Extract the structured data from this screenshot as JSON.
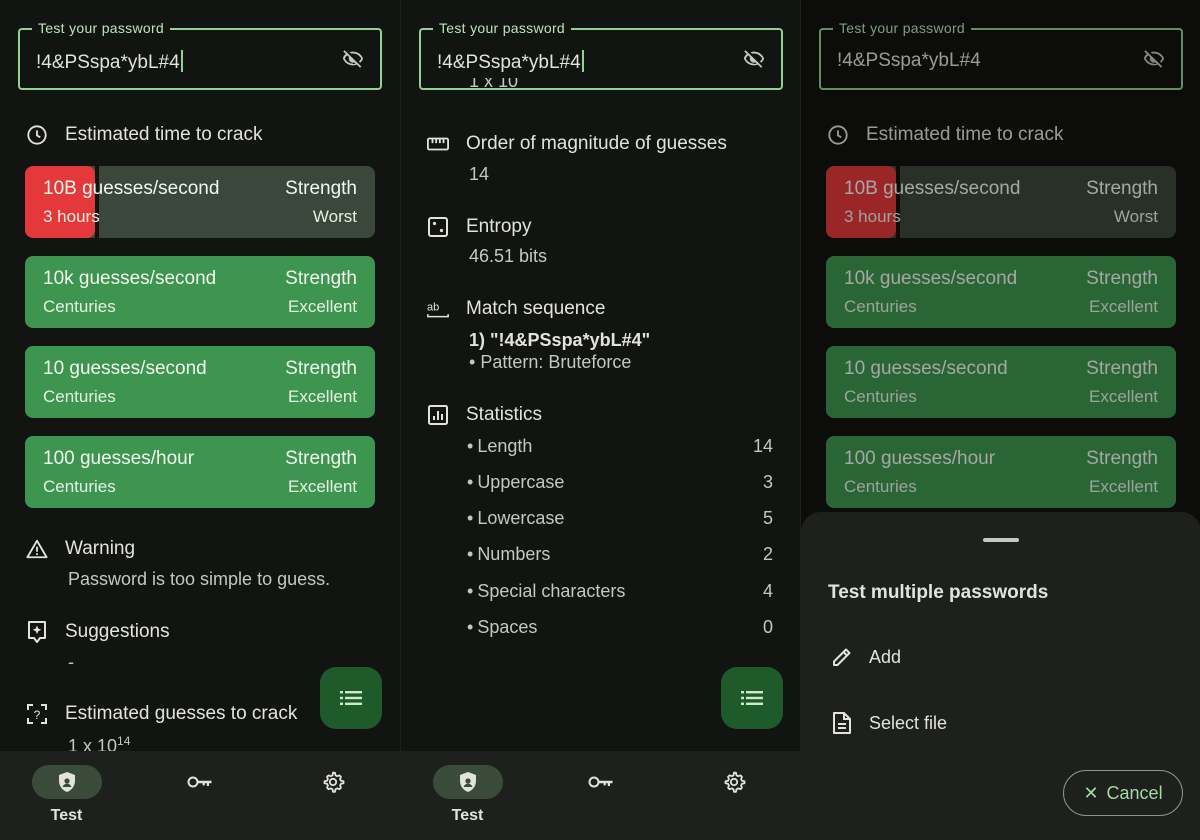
{
  "password_field": {
    "label": "Test your password",
    "value": "!4&PSspa*ybL#4"
  },
  "crack_time": {
    "title": "Estimated time to crack",
    "cards": [
      {
        "rate": "10B guesses/second",
        "time": "3 hours",
        "strength_label": "Strength",
        "strength": "Worst"
      },
      {
        "rate": "10k guesses/second",
        "time": "Centuries",
        "strength_label": "Strength",
        "strength": "Excellent"
      },
      {
        "rate": "10 guesses/second",
        "time": "Centuries",
        "strength_label": "Strength",
        "strength": "Excellent"
      },
      {
        "rate": "100 guesses/hour",
        "time": "Centuries",
        "strength_label": "Strength",
        "strength": "Excellent"
      }
    ]
  },
  "warning": {
    "title": "Warning",
    "text": "Password is too simple to guess."
  },
  "suggestions": {
    "title": "Suggestions",
    "text": "-"
  },
  "guesses": {
    "title": "Estimated guesses to crack",
    "base": "1 x 10",
    "exponent": "14",
    "cut_text": "1 x 10"
  },
  "magnitude": {
    "title": "Order of magnitude of guesses",
    "value": "14"
  },
  "entropy": {
    "title": "Entropy",
    "value": "46.51 bits"
  },
  "match_sequence": {
    "title": "Match sequence",
    "item": "1) \"!4&PSspa*ybL#4\"",
    "pattern": "Pattern: Bruteforce"
  },
  "statistics": {
    "title": "Statistics",
    "rows": [
      {
        "label": "Length",
        "value": "14"
      },
      {
        "label": "Uppercase",
        "value": "3"
      },
      {
        "label": "Lowercase",
        "value": "5"
      },
      {
        "label": "Numbers",
        "value": "2"
      },
      {
        "label": "Special characters",
        "value": "4"
      },
      {
        "label": "Spaces",
        "value": "0"
      }
    ]
  },
  "nav": {
    "test_label": "Test"
  },
  "sheet": {
    "title": "Test multiple passwords",
    "add": "Add",
    "select_file": "Select file",
    "cancel": "Cancel"
  },
  "colors": {
    "accent": "#8fd294",
    "strength_excellent": "#3e9550",
    "strength_worst": "#e5383b",
    "background": "#121411"
  },
  "icons": [
    "visibility-off-icon",
    "clock-icon",
    "warning-icon",
    "sparkle-icon",
    "scan-icon",
    "list-icon",
    "shield-icon",
    "key-icon",
    "gear-icon",
    "ruler-icon",
    "dice-icon",
    "ab-icon",
    "chart-icon",
    "pencil-icon",
    "file-icon",
    "close-icon"
  ]
}
